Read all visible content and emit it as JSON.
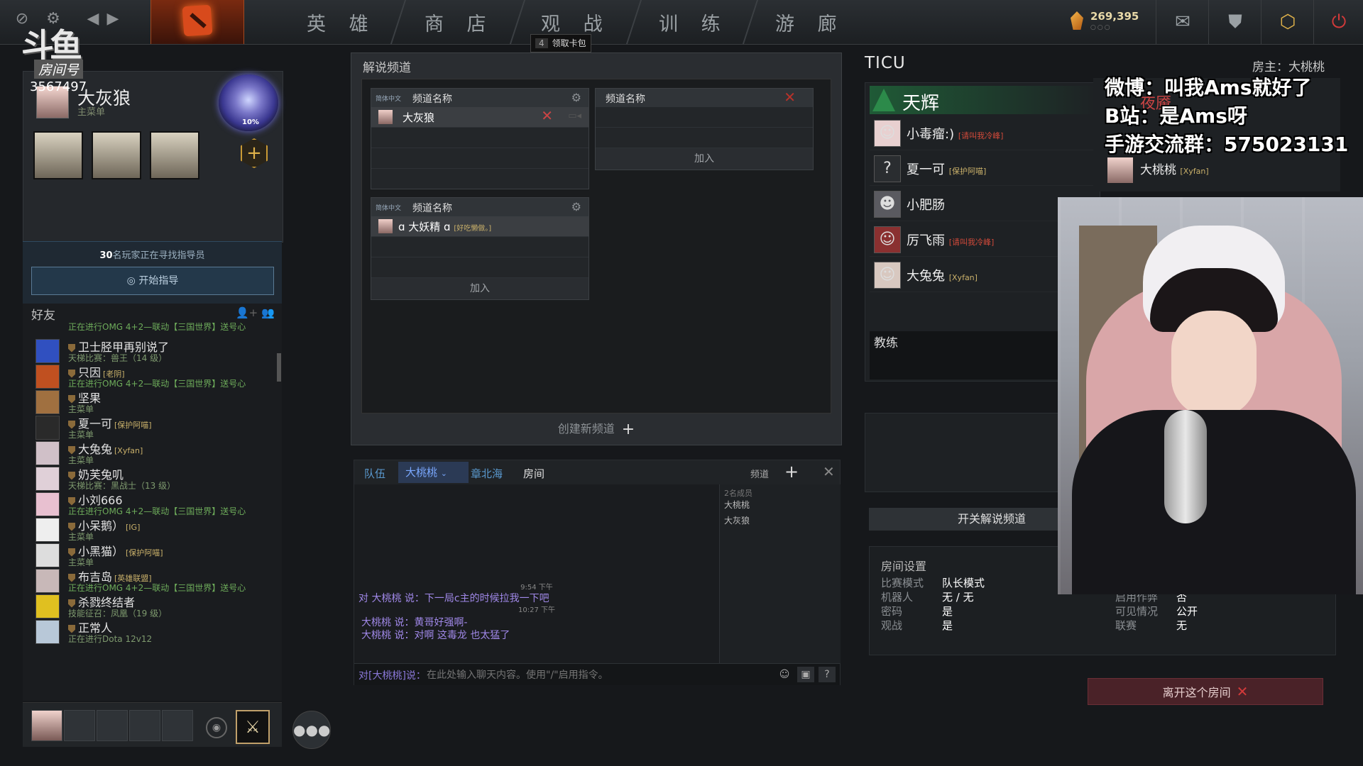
{
  "nav": {
    "items": [
      "英 雄",
      "商 店",
      "观 战",
      "训 练",
      "游 廊"
    ],
    "card_badge_num": "4",
    "card_badge_label": "领取卡包",
    "shards": "269,395",
    "shard_dots": "○○○"
  },
  "profile": {
    "logo_text": "斗鱼",
    "room_label": "房间号",
    "room_id": "3567497",
    "name": "大灰狼",
    "status": "主菜单",
    "medal_pct": "10%"
  },
  "coach": {
    "count": "30",
    "text": "名玩家正在寻找指导员",
    "button": "开始指导"
  },
  "friends": {
    "title": "好友",
    "top_cut": "正在进行OMG 4+2—联动【三国世界】送号心",
    "list": [
      {
        "name": "卫士胫甲再别说了",
        "tag": "",
        "sub": "天梯比赛：兽王（14 级）",
        "link": false
      },
      {
        "name": "只因",
        "tag": "[老阴]",
        "sub": "正在进行OMG 4+2—联动【三国世界】送号心",
        "link": true
      },
      {
        "name": "坚果",
        "tag": "",
        "sub": "主菜单",
        "link": false
      },
      {
        "name": "夏一可",
        "tag": "[保护阿喵]",
        "sub": "主菜单",
        "link": false
      },
      {
        "name": "大兔兔",
        "tag": "[Xyfan]",
        "sub": "主菜单",
        "link": false
      },
      {
        "name": "奶芙兔叽",
        "tag": "",
        "sub": "天梯比赛：黑战士（13 级）",
        "link": false
      },
      {
        "name": "小刘666",
        "tag": "",
        "sub": "正在进行OMG 4+2—联动【三国世界】送号心",
        "link": true
      },
      {
        "name": "小呆鹅）",
        "tag": "[IG]",
        "sub": "主菜单",
        "link": false
      },
      {
        "name": "小黑猫）",
        "tag": "[保护阿喵]",
        "sub": "主菜单",
        "link": false
      },
      {
        "name": "布吉岛",
        "tag": "[英雄联盟]",
        "sub": "正在进行OMG 4+2—联动【三国世界】送号心",
        "link": true
      },
      {
        "name": "杀戮终结者",
        "tag": "",
        "sub": "技能征召：凤凰（19 级）",
        "link": false
      },
      {
        "name": "正常人",
        "tag": "",
        "sub": "正在进行Dota 12v12",
        "link": false
      }
    ]
  },
  "channels": {
    "title": "解说频道",
    "create": "创建新频道",
    "lang": "简体中文",
    "name_label": "频道名称",
    "join": "加入",
    "ch1_member": "大灰狼",
    "ch3_member": "ɑ 大妖精 ɑ",
    "ch3_tag": "[好吃懒做。]"
  },
  "chat": {
    "tabs": [
      "队伍",
      "大桃桃",
      "章北海",
      "房间"
    ],
    "channel_label": "频道",
    "member_count": "2名成员",
    "members": [
      "大桃桃",
      "大灰狼"
    ],
    "ts1": "9:54 下午",
    "msg1_who": "对 大桃桃 说：",
    "msg1_text": "下一局c主的时候拉我一下吧",
    "ts2": "10:27 下午",
    "msg2_who": "大桃桃 说：",
    "msg2_text": "黄哥好强啊-",
    "msg3_who": "大桃桃 说：",
    "msg3_text": "对啊 这毒龙 也太猛了",
    "input_prefix": "对[大桃桃]说：",
    "input_placeholder": "在此处输入聊天内容。使用\"/\"启用指令。"
  },
  "lobby": {
    "name": "TICU",
    "host": "房主：大桃桃",
    "radiant": "天辉",
    "dire": "夜魇",
    "players": [
      {
        "name": "小毒瘤:)",
        "tag": "[请叫我冷峰]",
        "tagcolor": "r"
      },
      {
        "name": "夏一可",
        "tag": "[保护阿喵]",
        "tagcolor": "y"
      },
      {
        "name": "小肥肠",
        "tag": "",
        "tagcolor": "y"
      },
      {
        "name": "厉飞雨",
        "tag": "[请叫我冷峰]",
        "tagcolor": "r"
      },
      {
        "name": "大兔兔",
        "tag": "[Xyfan]",
        "tagcolor": "y"
      }
    ],
    "dire_player": "大桃桃",
    "dire_tag": "[Xyfan]",
    "coach_label": "教练",
    "toggle": "开关解说频道",
    "settings_title": "房间设置",
    "settings_left": [
      {
        "k": "比赛模式",
        "v": "队长模式"
      },
      {
        "k": "机器人",
        "v": "无 / 无"
      },
      {
        "k": "密码",
        "v": "是"
      },
      {
        "k": "观战",
        "v": "是"
      }
    ],
    "settings_right": [
      {
        "k": "启用作弊",
        "v": "否"
      },
      {
        "k": "可见情况",
        "v": "公开"
      },
      {
        "k": "联赛",
        "v": "无"
      }
    ],
    "leave": "离开这个房间"
  },
  "overlay": {
    "line1": "微博：叫我Ams就好了",
    "line2": "B站：是Ams呀",
    "line3": "手游交流群：575023131"
  }
}
